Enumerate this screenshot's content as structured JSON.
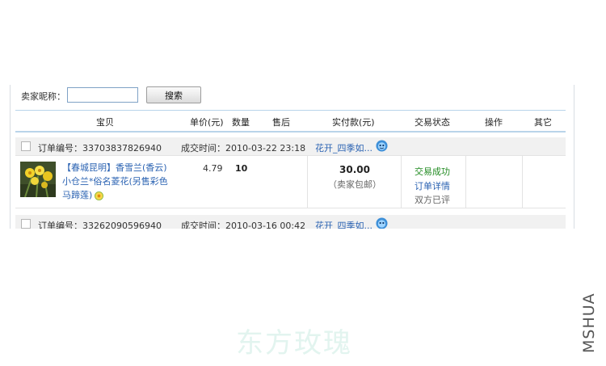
{
  "search": {
    "label": "卖家昵称：",
    "input_value": "",
    "input_placeholder": "",
    "button_label": "搜索"
  },
  "table_header": {
    "item": "宝贝",
    "unit_price": "单价(元)",
    "quantity": "数量",
    "after_sale": "售后",
    "paid": "实付款(元)",
    "status": "交易状态",
    "actions": "操作",
    "other": "其它"
  },
  "orders": [
    {
      "order_number": "订单编号：33703837826940",
      "deal_time": "成交时间：2010-03-22 23:18",
      "shop_name": "花开_四季如...",
      "item_title": "【春城昆明】香雪兰(香云)小仓兰*俗名菱花(另售彩色马蹄莲)",
      "unit_price": "4.79",
      "quantity": "10",
      "paid_amount": "30.00",
      "paid_note": "（卖家包邮）",
      "status_text": "交易成功",
      "order_detail_link": "订单详情",
      "review_status": "双方已评"
    },
    {
      "order_number": "订单编号：33262090596940",
      "deal_time": "成交时间：2010-03-16 00:42",
      "shop_name": "花开_四季如..."
    }
  ],
  "colors": {
    "link": "#2a62b2",
    "success": "#228b22",
    "header_border": "#b9d4ea",
    "order_bar": "#f1f1f1"
  },
  "icons": {
    "chat": "wangwang-chat-icon",
    "badge": "flower-badge-icon"
  },
  "watermarks": {
    "center": "东方玫瑰",
    "side": "MSHUA"
  }
}
